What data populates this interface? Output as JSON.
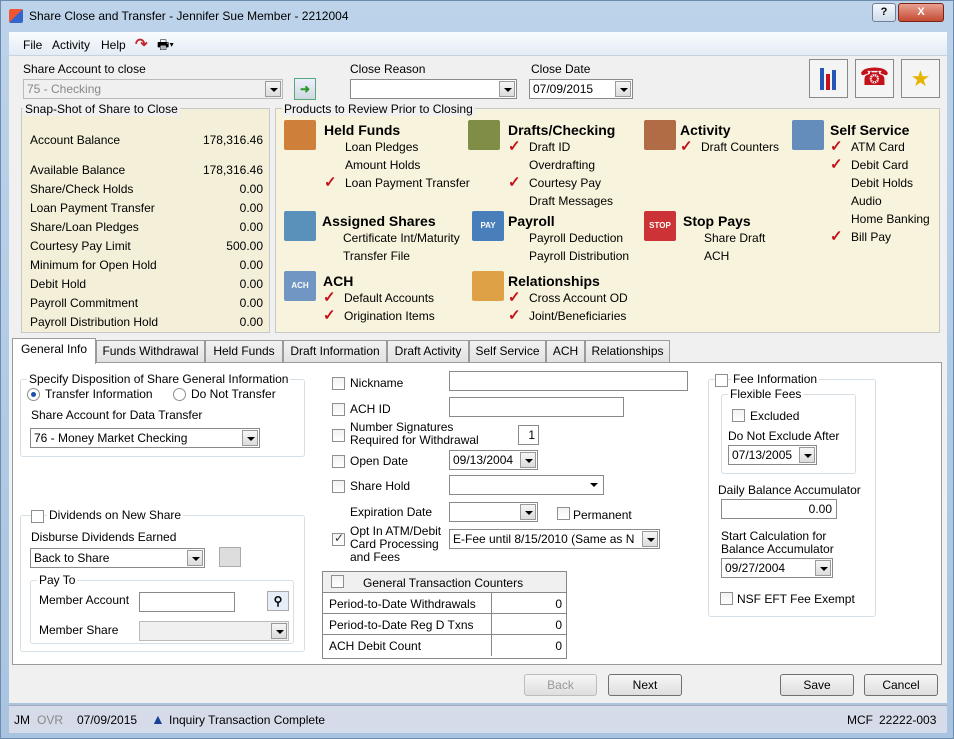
{
  "window": {
    "title": "Share Close and Transfer - Jennifer Sue Member - 2212004",
    "help_label": "?",
    "close_label": "X"
  },
  "menu": {
    "file": "File",
    "activity": "Activity",
    "help": "Help"
  },
  "top": {
    "share_account_label": "Share Account to close",
    "share_account_value": "75 - Checking",
    "close_reason_label": "Close Reason",
    "close_reason_value": "",
    "close_date_label": "Close Date",
    "close_date_value": "07/09/2015"
  },
  "snapshot": {
    "title": "Snap-Shot of Share to Close",
    "rows": [
      {
        "label": "Account Balance",
        "value": "178,316.46"
      },
      {
        "label": "Available Balance",
        "value": "178,316.46"
      },
      {
        "label": "Share/Check Holds",
        "value": "0.00"
      },
      {
        "label": "Loan Payment Transfer",
        "value": "0.00"
      },
      {
        "label": "Share/Loan Pledges",
        "value": "0.00"
      },
      {
        "label": "Courtesy Pay Limit",
        "value": "500.00"
      },
      {
        "label": "Minimum for Open Hold",
        "value": "0.00"
      },
      {
        "label": "Debit Hold",
        "value": "0.00"
      },
      {
        "label": "Payroll  Commitment",
        "value": "0.00"
      },
      {
        "label": "Payroll Distribution Hold",
        "value": "0.00"
      }
    ]
  },
  "products": {
    "title": "Products to Review Prior to Closing",
    "held_funds": {
      "title": "Held Funds",
      "items": [
        "Loan Pledges",
        "Amount Holds",
        "Loan Payment Transfer"
      ]
    },
    "drafts": {
      "title": "Drafts/Checking",
      "items": [
        "Draft ID",
        "Overdrafting",
        "Courtesy Pay",
        "Draft Messages"
      ]
    },
    "activity": {
      "title": "Activity",
      "items": [
        "Draft Counters"
      ]
    },
    "self_service": {
      "title": "Self Service",
      "items": [
        "ATM Card",
        "Debit Card",
        "Debit Holds",
        "Audio",
        "Home Banking",
        "Bill Pay"
      ]
    },
    "assigned": {
      "title": "Assigned Shares",
      "items": [
        "Certificate Int/Maturity",
        "Transfer File"
      ]
    },
    "payroll": {
      "title": "Payroll",
      "icon_text": "PAY",
      "items": [
        "Payroll Deduction",
        "Payroll Distribution"
      ]
    },
    "stop_pays": {
      "title": "Stop Pays",
      "icon_text": "STOP",
      "items": [
        "Share Draft",
        "ACH"
      ]
    },
    "ach": {
      "title": "ACH",
      "icon_text": "ACH",
      "items": [
        "Default Accounts",
        "Origination Items"
      ]
    },
    "relationships": {
      "title": "Relationships",
      "items": [
        "Cross Account OD",
        "Joint/Beneficiaries"
      ]
    },
    "check_mark": "✓"
  },
  "tabs": [
    "General Info",
    "Funds Withdrawal",
    "Held Funds",
    "Draft Information",
    "Draft Activity",
    "Self Service",
    "ACH",
    "Relationships"
  ],
  "general": {
    "disposition_title": "Specify Disposition of Share General Information",
    "transfer_info": "Transfer Information",
    "do_not_transfer": "Do Not Transfer",
    "share_account_transfer_label": "Share Account for Data Transfer",
    "share_account_transfer_value": "76 - Money Market Checking",
    "dividends_label": "Dividends on New Share",
    "disburse_label": "Disburse Dividends Earned",
    "disburse_value": "Back to Share",
    "pay_to": "Pay To",
    "member_account": "Member Account",
    "member_share": "Member Share",
    "nickname": "Nickname",
    "ach_id": "ACH ID",
    "num_sig": "Number Signatures\nRequired for Withdrawal",
    "num_sig_value": "1",
    "open_date": "Open Date",
    "open_date_value": "09/13/2004",
    "share_hold": "Share Hold",
    "expiration_date": "Expiration Date",
    "permanent": "Permanent",
    "opt_in": "Opt In ATM/Debit\nCard Processing\nand Fees",
    "opt_in_value": "E-Fee until 8/15/2010 (Same as N",
    "counters_title": "General Transaction Counters",
    "counters": [
      {
        "label": "Period-to-Date Withdrawals",
        "value": "0"
      },
      {
        "label": "Period-to-Date Reg D Txns",
        "value": "0"
      },
      {
        "label": "ACH Debit Count",
        "value": "0"
      }
    ],
    "fee_info": "Fee Information",
    "flexible_fees": "Flexible Fees",
    "excluded": "Excluded",
    "do_not_exclude": "Do Not Exclude After",
    "do_not_exclude_value": "07/13/2005",
    "daily_balance": "Daily Balance Accumulator",
    "daily_balance_value": "0.00",
    "start_calc": "Start Calculation for\nBalance Accumulator",
    "start_calc_value": "09/27/2004",
    "nsf": "NSF EFT Fee Exempt"
  },
  "buttons": {
    "back": "Back",
    "next": "Next",
    "save": "Save",
    "cancel": "Cancel"
  },
  "status": {
    "user": "JM",
    "ovr": "OVR",
    "date": "07/09/2015",
    "message": "Inquiry Transaction Complete",
    "mcf": "MCF",
    "code": "22222-003"
  },
  "colors": {
    "check": "#c4121a",
    "panel_bg": "#f8f3dc",
    "title_bar": "#bcd3ea"
  }
}
